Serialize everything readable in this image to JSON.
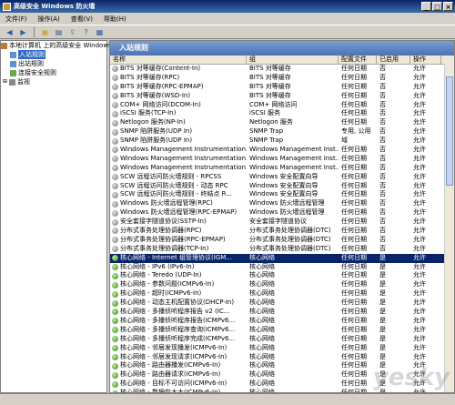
{
  "window": {
    "title": "高级安全 Windows 防火墙"
  },
  "menu": [
    "文件(F)",
    "操作(A)",
    "查看(V)",
    "帮助(H)"
  ],
  "tree": {
    "root": "本地计算机 上的高级安全 Windows",
    "items": [
      "入站规则",
      "出站规则",
      "连接安全规则",
      "监视"
    ],
    "selected": "入站规则"
  },
  "pane": {
    "header": "入站规则"
  },
  "columns": [
    "名称",
    "组",
    "配置文件",
    "已启用",
    "操作"
  ],
  "rows": [
    [
      "BITS 对等缓存(Content-In)",
      "BITS 对等缓存",
      "任何日期",
      "否",
      "允许",
      "gray"
    ],
    [
      "BITS 对等缓存(RPC)",
      "BITS 对等缓存",
      "任何日期",
      "否",
      "允许",
      "gray"
    ],
    [
      "BITS 对等缓存(RPC-EPMAP)",
      "BITS 对等缓存",
      "任何日期",
      "否",
      "允许",
      "gray"
    ],
    [
      "BITS 对等缓存(WSD-In)",
      "BITS 对等缓存",
      "任何日期",
      "否",
      "允许",
      "gray"
    ],
    [
      "COM+ 网络访问(DCOM-In)",
      "COM+ 网络访问",
      "任何日期",
      "否",
      "允许",
      "gray"
    ],
    [
      "iSCSI 服务(TCP-In)",
      "iSCSI 服务",
      "任何日期",
      "否",
      "允许",
      "gray"
    ],
    [
      "Netlogon 服务(NP-In)",
      "Netlogon 服务",
      "任何日期",
      "否",
      "允许",
      "gray"
    ],
    [
      "SNMP 陷阱服务(UDP In)",
      "SNMP Trap",
      "专用, 公用",
      "否",
      "允许",
      "gray"
    ],
    [
      "SNMP 陷阱服务(UDP In)",
      "SNMP Trap",
      "域",
      "否",
      "允许",
      "gray"
    ],
    [
      "Windows Management Instrumentation...",
      "Windows Management Inst...",
      "任何日期",
      "否",
      "允许",
      "gray"
    ],
    [
      "Windows Management Instrumentation...",
      "Windows Management Inst...",
      "任何日期",
      "否",
      "允许",
      "gray"
    ],
    [
      "Windows Management Instrumentation...",
      "Windows Management Inst...",
      "任何日期",
      "否",
      "允许",
      "gray"
    ],
    [
      "SCW 远程访问防火墙规则 - RPCSS",
      "Windows 安全配置向导",
      "任何日期",
      "否",
      "允许",
      "gray"
    ],
    [
      "SCW 远程访问防火墙规则 - 动态 RPC",
      "Windows 安全配置向导",
      "任何日期",
      "否",
      "允许",
      "gray"
    ],
    [
      "SCW 远程访问防火墙规则 - 终结点 R...",
      "Windows 安全配置向导",
      "任何日期",
      "否",
      "允许",
      "gray"
    ],
    [
      "Windows 防火墙远程管理(RPC)",
      "Windows 防火墙远程管理",
      "任何日期",
      "否",
      "允许",
      "gray"
    ],
    [
      "Windows 防火墙远程管理(RPC-EPMAP)",
      "Windows 防火墙远程管理",
      "任何日期",
      "否",
      "允许",
      "gray"
    ],
    [
      "安全套接字隧道协议(SSTP-In)",
      "安全套接字隧道协议",
      "任何日期",
      "否",
      "允许",
      "gray"
    ],
    [
      "分布式事务处理协调器(RPC)",
      "分布式事务处理协调器(DTC)",
      "任何日期",
      "否",
      "允许",
      "gray"
    ],
    [
      "分布式事务处理协调器(RPC-EPMAP)",
      "分布式事务处理协调器(DTC)",
      "任何日期",
      "否",
      "允许",
      "gray"
    ],
    [
      "分布式事务处理协调器(TCP-In)",
      "分布式事务处理协调器(DTC)",
      "任何日期",
      "否",
      "允许",
      "gray"
    ],
    [
      "核心网络 - Internet 组管理协议(IGM...",
      "核心网络",
      "任何日期",
      "是",
      "允许",
      "green"
    ],
    [
      "核心网络 - IPv6 (IPv6-In)",
      "核心网络",
      "任何日期",
      "是",
      "允许",
      "green"
    ],
    [
      "核心网络 - Teredo (UDP-In)",
      "核心网络",
      "任何日期",
      "是",
      "允许",
      "green"
    ],
    [
      "核心网络 - 参数问题(ICMPv6-In)",
      "核心网络",
      "任何日期",
      "是",
      "允许",
      "green"
    ],
    [
      "核心网络 - 超时(ICMPv6-In)",
      "核心网络",
      "任何日期",
      "是",
      "允许",
      "green"
    ],
    [
      "核心网络 - 动态主机配置协议(DHCP-In)",
      "核心网络",
      "任何日期",
      "是",
      "允许",
      "green"
    ],
    [
      "核心网络 - 多播侦听程序报告 v2 (IC...",
      "核心网络",
      "任何日期",
      "是",
      "允许",
      "green"
    ],
    [
      "核心网络 - 多播侦听程序报告(ICMPv6...",
      "核心网络",
      "任何日期",
      "是",
      "允许",
      "green"
    ],
    [
      "核心网络 - 多播侦听程序查询(ICMPv6...",
      "核心网络",
      "任何日期",
      "是",
      "允许",
      "green"
    ],
    [
      "核心网络 - 多播侦听程序完成(ICMPv6...",
      "核心网络",
      "任何日期",
      "是",
      "允许",
      "green"
    ],
    [
      "核心网络 - 邻居发现播发(ICMPv6-In)",
      "核心网络",
      "任何日期",
      "是",
      "允许",
      "green"
    ],
    [
      "核心网络 - 邻居发现请求(ICMPv6-In)",
      "核心网络",
      "任何日期",
      "是",
      "允许",
      "green"
    ],
    [
      "核心网络 - 路由器播发(ICMPv6-In)",
      "核心网络",
      "任何日期",
      "是",
      "允许",
      "green"
    ],
    [
      "核心网络 - 路由器请求(ICMPv6-In)",
      "核心网络",
      "任何日期",
      "是",
      "允许",
      "green"
    ],
    [
      "核心网络 - 目标不可访问(ICMPv6-In)",
      "核心网络",
      "任何日期",
      "是",
      "允许",
      "green"
    ],
    [
      "核心网络 - 数据包太大(ICMPv6-In)",
      "核心网络",
      "任何日期",
      "是",
      "允许",
      "green"
    ]
  ],
  "selected_row": 21,
  "watermark": "yesky"
}
